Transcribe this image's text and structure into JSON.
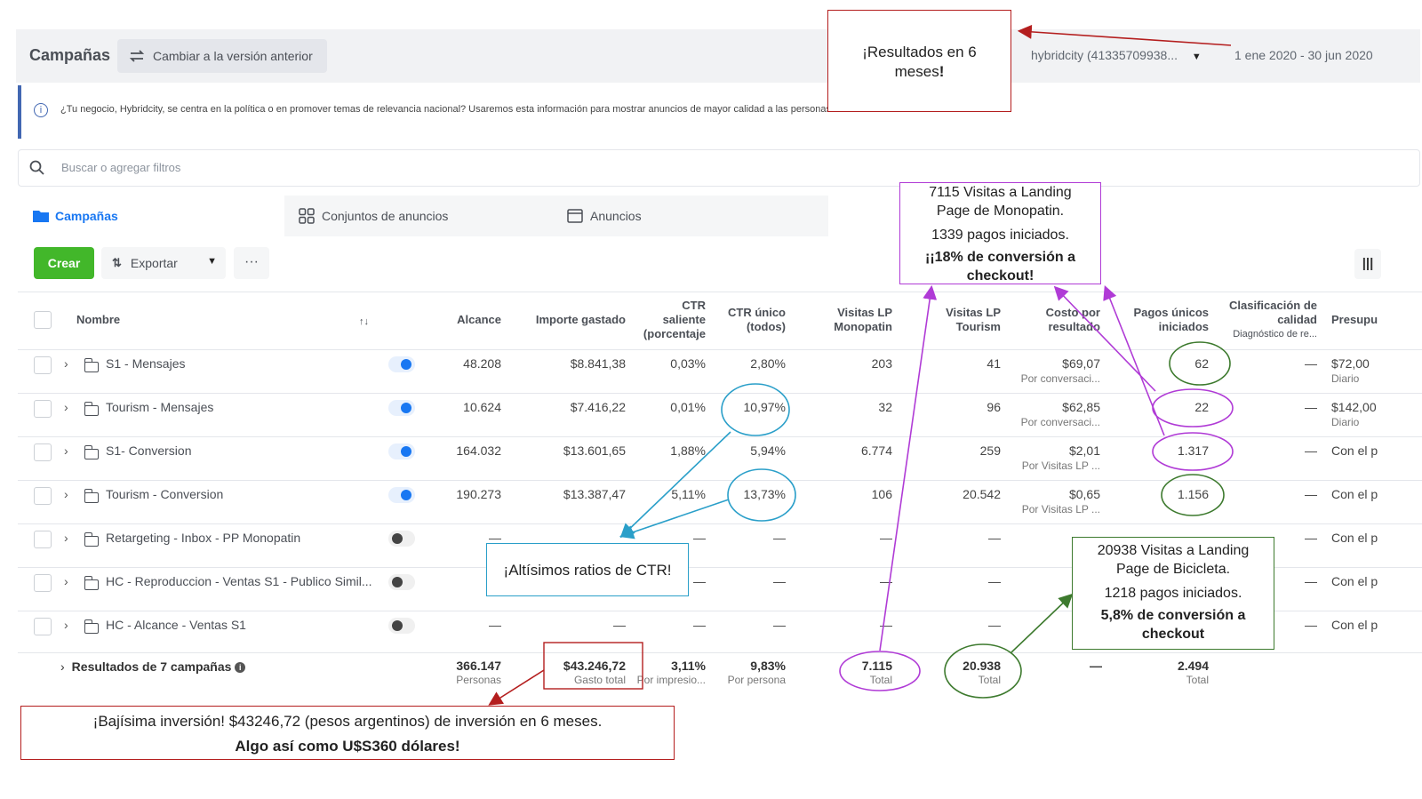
{
  "header": {
    "title": "Campañas",
    "prev_version_label": "Cambiar a la versión anterior",
    "account": "hybridcity (41335709938...",
    "date_range": "1 ene 2020 - 30 jun 2020"
  },
  "info_message": "¿Tu negocio, Hybridcity, se centra en la política o en promover temas de relevancia nacional? Usaremos esta información para mostrar anuncios de mayor calidad a las personas.",
  "search": {
    "placeholder": "Buscar o agregar filtros"
  },
  "tabs": [
    {
      "label": "Campañas",
      "icon": "folder-icon"
    },
    {
      "label": "Conjuntos de anuncios",
      "icon": "grid-icon"
    },
    {
      "label": "Anuncios",
      "icon": "ad-icon"
    }
  ],
  "toolbar": {
    "create_label": "Crear",
    "export_label": "Exportar",
    "more_label": "···",
    "columns_label": "|||"
  },
  "columns": {
    "name": "Nombre",
    "sort": "↑↓",
    "reach": "Alcance",
    "spent": "Importe gastado",
    "ctr_out_1": "CTR",
    "ctr_out_2": "saliente",
    "ctr_out_3": "(porcentaje",
    "ctr_unique_1": "CTR único",
    "ctr_unique_2": "(todos)",
    "lp_mono_1": "Visitas LP",
    "lp_mono_2": "Monopatin",
    "lp_tour_1": "Visitas LP",
    "lp_tour_2": "Tourism",
    "cost_1": "Costo por",
    "cost_2": "resultado",
    "payments_1": "Pagos únicos",
    "payments_2": "iniciados",
    "quality_1": "Clasificación de",
    "quality_2": "calidad",
    "quality_3": "Diagnóstico de re...",
    "budget": "Presupu"
  },
  "rows": [
    {
      "name": "S1 - Mensajes",
      "on": true,
      "reach": "48.208",
      "spent": "$8.841,38",
      "ctr_out": "0,03%",
      "ctr_unique": "2,80%",
      "lp_mono": "203",
      "lp_tour": "41",
      "cost": "$69,07",
      "cost_sub": "Por conversaci...",
      "payments": "62",
      "quality": "—",
      "budget": "$72,00",
      "budget_sub": "Diario"
    },
    {
      "name": "Tourism - Mensajes",
      "on": true,
      "reach": "10.624",
      "spent": "$7.416,22",
      "ctr_out": "0,01%",
      "ctr_unique": "10,97%",
      "lp_mono": "32",
      "lp_tour": "96",
      "cost": "$62,85",
      "cost_sub": "Por conversaci...",
      "payments": "22",
      "quality": "—",
      "budget": "$142,00",
      "budget_sub": "Diario"
    },
    {
      "name": "S1- Conversion",
      "on": true,
      "reach": "164.032",
      "spent": "$13.601,65",
      "ctr_out": "1,88%",
      "ctr_unique": "5,94%",
      "lp_mono": "6.774",
      "lp_tour": "259",
      "cost": "$2,01",
      "cost_sub": "Por Visitas LP ...",
      "payments": "1.317",
      "quality": "—",
      "budget": "Con el p",
      "budget_sub": ""
    },
    {
      "name": "Tourism - Conversion",
      "on": true,
      "reach": "190.273",
      "spent": "$13.387,47",
      "ctr_out": "5,11%",
      "ctr_unique": "13,73%",
      "lp_mono": "106",
      "lp_tour": "20.542",
      "cost": "$0,65",
      "cost_sub": "Por Visitas LP ...",
      "payments": "1.156",
      "quality": "—",
      "budget": "Con el p",
      "budget_sub": ""
    },
    {
      "name": "Retargeting - Inbox - PP Monopatin",
      "on": false,
      "reach": "—",
      "spent": "",
      "ctr_out": "—",
      "ctr_unique": "—",
      "lp_mono": "—",
      "lp_tour": "—",
      "cost": "",
      "cost_sub": "",
      "payments": "",
      "quality": "—",
      "budget": "Con el p",
      "budget_sub": ""
    },
    {
      "name": "HC - Reproduccion - Ventas S1 - Publico Simil...",
      "on": false,
      "reach": "",
      "spent": "",
      "ctr_out": "—",
      "ctr_unique": "—",
      "lp_mono": "—",
      "lp_tour": "—",
      "cost": "",
      "cost_sub": "",
      "payments": "",
      "quality": "—",
      "budget": "Con el p",
      "budget_sub": ""
    },
    {
      "name": "HC - Alcance - Ventas S1",
      "on": false,
      "reach": "—",
      "spent": "—",
      "ctr_out": "—",
      "ctr_unique": "—",
      "lp_mono": "—",
      "lp_tour": "—",
      "cost": "",
      "cost_sub": "",
      "payments": "",
      "quality": "—",
      "budget": "Con el p",
      "budget_sub": ""
    }
  ],
  "totals": {
    "label": "Resultados de 7 campañas",
    "reach": "366.147",
    "reach_sub": "Personas",
    "spent": "$43.246,72",
    "spent_sub": "Gasto total",
    "ctr_out": "3,11%",
    "ctr_out_sub": "Por impresio...",
    "ctr_unique": "9,83%",
    "ctr_unique_sub": "Por persona",
    "lp_mono": "7.115",
    "lp_mono_sub": "Total",
    "lp_tour": "20.938",
    "lp_tour_sub": "Total",
    "cost": "—",
    "payments": "2.494",
    "payments_sub": "Total"
  },
  "annotations": {
    "results": {
      "line1": "¡Resultados en 6",
      "line2": "meses",
      "bang": "!"
    },
    "monopatin": {
      "line1": "7115 Visitas a Landing",
      "line2": "Page de Monopatin.",
      "line3": "1339 pagos iniciados.",
      "line4": "¡¡18% de conversión a",
      "line5": "checkout!"
    },
    "ctr": {
      "text": "¡Altísimos ratios de CTR!"
    },
    "bicicleta": {
      "line1": "20938 Visitas a Landing",
      "line2": "Page de Bicicleta.",
      "line3": "1218 pagos iniciados.",
      "line4": "5,8% de conversión a",
      "line5": "checkout"
    },
    "investment": {
      "line1": "¡Bajísima inversión! $43246,72 (pesos argentinos) de inversión en 6 meses.",
      "line2": "Algo así como U$S360 dólares!"
    }
  },
  "colors": {
    "red": "#b41e1e",
    "purple": "#b03bd6",
    "teal": "#2a9fc9",
    "green": "#3d7a2e",
    "brand": "#1877f2",
    "create": "#42b72a"
  }
}
